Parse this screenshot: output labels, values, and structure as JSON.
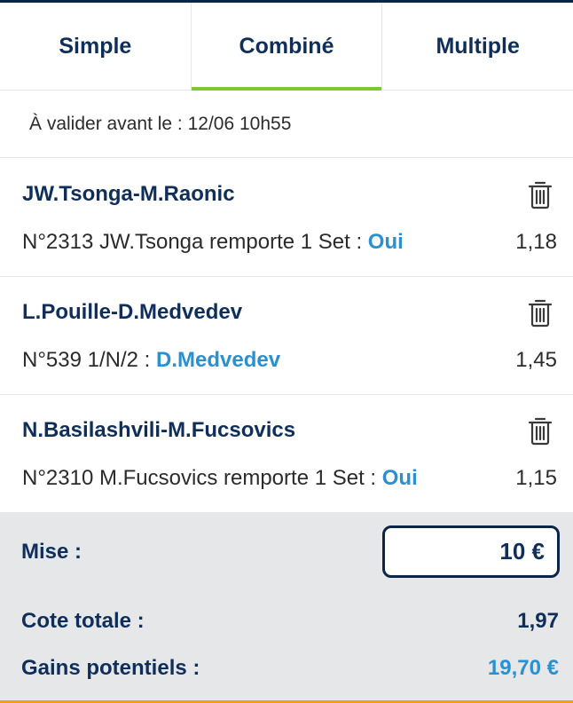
{
  "tabs": [
    {
      "label": "Simple",
      "active": false
    },
    {
      "label": "Combiné",
      "active": true
    },
    {
      "label": "Multiple",
      "active": false
    }
  ],
  "deadline": "À valider avant le : 12/06 10h55",
  "bets": [
    {
      "match": "JW.Tsonga-M.Raonic",
      "market": "N°2313 JW.Tsonga remporte 1 Set : ",
      "selection": "Oui",
      "odd": "1,18"
    },
    {
      "match": "L.Pouille-D.Medvedev",
      "market": "N°539 1/N/2 : ",
      "selection": "D.Medvedev",
      "odd": "1,45"
    },
    {
      "match": "N.Basilashvili-M.Fucsovics",
      "market": "N°2310 M.Fucsovics remporte 1 Set : ",
      "selection": "Oui",
      "odd": "1,15"
    }
  ],
  "summary": {
    "mise_label": "Mise :",
    "mise_value": "10 €",
    "cote_label": "Cote totale :",
    "cote_value": "1,97",
    "gains_label": "Gains potentiels :",
    "gains_value": "19,70 €"
  },
  "icons": {
    "delete": "trash-icon"
  },
  "colors": {
    "navy": "#0f2f5a",
    "active_tab_underline": "#7cc82e",
    "selection_blue": "#2b8fd0",
    "summary_bg": "#e6e7e9"
  }
}
